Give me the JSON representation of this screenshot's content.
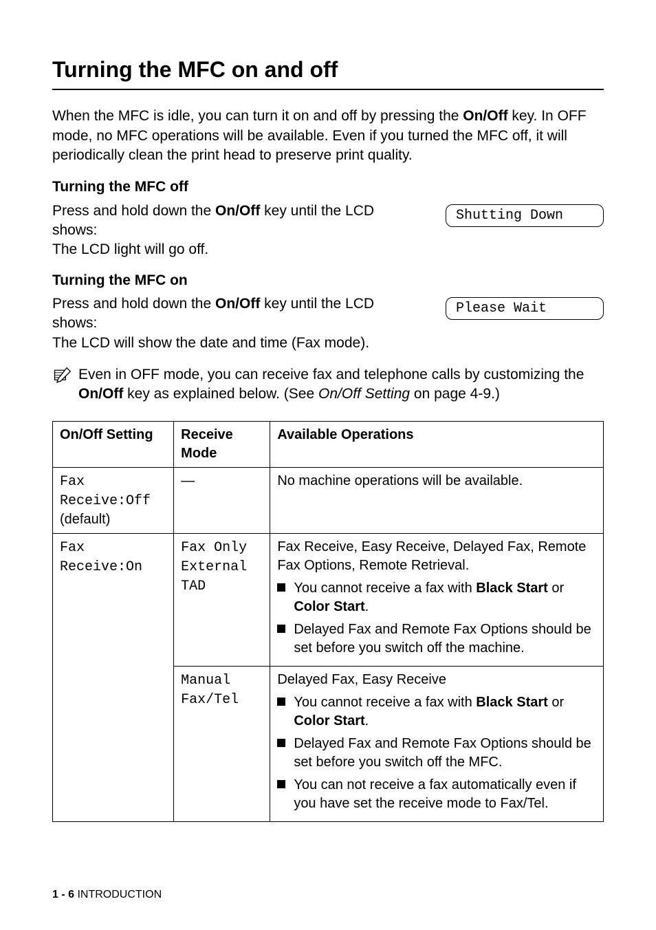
{
  "heading": "Turning the MFC on and off",
  "intro_parts": {
    "a": "When the MFC is idle, you can turn it on and off by pressing the ",
    "b": "On/Off",
    "c": " key. In OFF mode, no MFC operations will be available. Even if you turned the MFC off, it will periodically clean the print head to preserve print quality."
  },
  "sec_off": {
    "title": "Turning the MFC off",
    "line1a": "Press and hold down the ",
    "line1b": "On/Off",
    "line1c": " key until the LCD shows:",
    "lcd": "Shutting Down",
    "after": "The LCD light will go off."
  },
  "sec_on": {
    "title": "Turning the MFC on",
    "line1a": "Press and hold down the ",
    "line1b": "On/Off",
    "line1c": " key until the LCD shows:",
    "lcd": "Please Wait",
    "after": "The LCD will show the date and time (Fax mode)."
  },
  "note": {
    "a": "Even in OFF mode, you can receive fax and telephone calls by customizing the ",
    "b": "On/Off",
    "c": " key as explained below. (See ",
    "d": "On/Off Setting",
    "e": " on page 4-9.)"
  },
  "table": {
    "headers": {
      "c1": "On/Off Setting",
      "c2": "Receive Mode",
      "c3": "Available Operations"
    },
    "row1": {
      "setting_mono": "Fax Receive:Off",
      "setting_plain": "(default)",
      "mode": "—",
      "ops": "No machine operations will be available."
    },
    "row2": {
      "setting_mono": "Fax Receive:On",
      "mode1": "Fax Only",
      "mode2": "External TAD",
      "ops_intro": "Fax Receive, Easy Receive, Delayed Fax, Remote Fax Options, Remote Retrieval.",
      "li1a": "You cannot receive a fax with ",
      "li1b": "Black Start",
      "li1c": " or ",
      "li1d": "Color Start",
      "li1e": ".",
      "li2": "Delayed Fax and Remote Fax Options should be set before you switch off the machine."
    },
    "row3": {
      "mode1": "Manual",
      "mode2": "Fax/Tel",
      "ops_intro": "Delayed Fax, Easy Receive",
      "li1a": "You cannot receive a fax with ",
      "li1b": "Black Start",
      "li1c": " or ",
      "li1d": "Color Start",
      "li1e": ".",
      "li2": "Delayed Fax and Remote Fax Options should be set before you switch off the MFC.",
      "li3": "You can not receive a fax automatically even if you have set the receive mode to Fax/Tel."
    }
  },
  "footer": {
    "page": "1 - 6",
    "section": "   INTRODUCTION"
  }
}
